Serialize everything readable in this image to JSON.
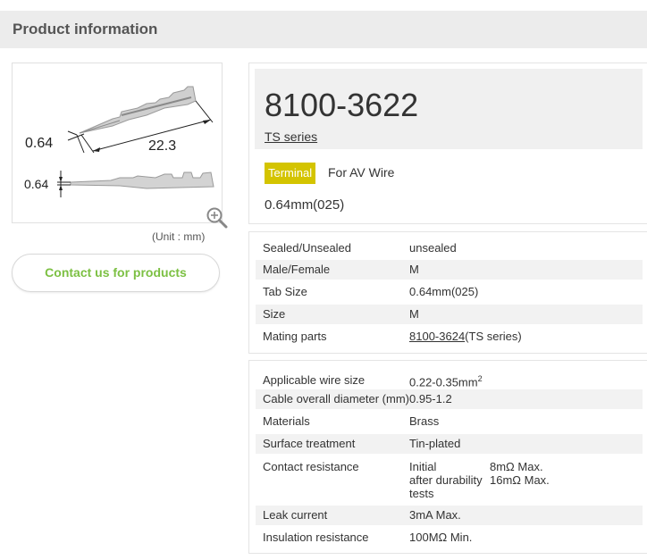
{
  "header": {
    "title": "Product information"
  },
  "image": {
    "dim_thickness": "0.64",
    "dim_length": "22.3",
    "dim_side": "0.64",
    "unit_note": "(Unit : mm)",
    "zoom_icon": "magnifier-icon"
  },
  "contact_button": "Contact us for products",
  "product": {
    "part_number": "8100-3622",
    "series": "TS series",
    "badge": "Terminal",
    "for": "For AV Wire",
    "size": "0.64mm(025)"
  },
  "colors": {
    "badge": "#d4c400",
    "contact_text": "#7cc043",
    "header_bg": "#ececec"
  },
  "specs1": [
    {
      "label": "Sealed/Unsealed",
      "value": "unsealed"
    },
    {
      "label": "Male/Female",
      "value": "M"
    },
    {
      "label": "Tab Size",
      "value": "0.64mm(025)"
    },
    {
      "label": "Size",
      "value": "M"
    },
    {
      "label": "Mating parts",
      "value_link": "8100-3624",
      "value_suffix": "(TS series)"
    }
  ],
  "specs2": {
    "wire_size": {
      "label": "Applicable wire size",
      "value": "0.22-0.35mm",
      "sup": "2"
    },
    "cable_diameter": {
      "label": "Cable overall diameter (mm)",
      "value": "0.95-1.2"
    },
    "materials": {
      "label": "Materials",
      "value": "Brass"
    },
    "surface": {
      "label": "Surface treatment",
      "value": "Tin-plated"
    },
    "contact_resistance": {
      "label": "Contact resistance",
      "initial": "Initial",
      "initial_value": "8mΩ Max.",
      "after_line1": "after durability",
      "after_line2": "tests",
      "after_value": "16mΩ Max."
    },
    "leak_current": {
      "label": "Leak current",
      "value": "3mA Max."
    },
    "insulation": {
      "label": "Insulation resistance",
      "value": "100MΩ Min."
    }
  }
}
